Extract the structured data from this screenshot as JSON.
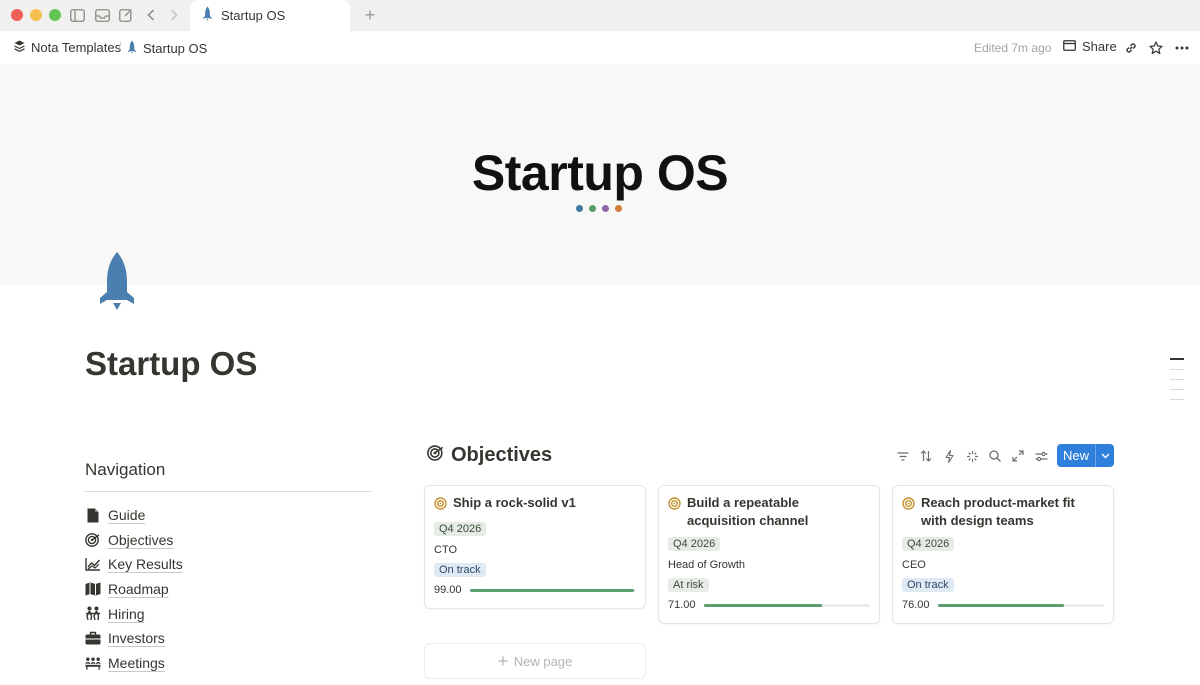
{
  "window": {
    "tab_title": "Startup OS"
  },
  "breadcrumb": {
    "workspace": "Nota Templates",
    "page": "Startup OS"
  },
  "topbar": {
    "edited": "Edited 7m ago",
    "share_label": "Share"
  },
  "cover": {
    "title": "Startup OS",
    "dot_colors": [
      "#3f7a9c",
      "#5b9a6b",
      "#8d6aa6",
      "#d47c3a"
    ]
  },
  "page": {
    "title": "Startup OS",
    "icon": "rocket-icon",
    "icon_color": "#4a7fb0"
  },
  "navigation": {
    "heading": "Navigation",
    "items": [
      {
        "label": "Guide",
        "icon": "document-icon"
      },
      {
        "label": "Objectives",
        "icon": "target-icon"
      },
      {
        "label": "Key Results",
        "icon": "chart-icon"
      },
      {
        "label": "Roadmap",
        "icon": "map-icon"
      },
      {
        "label": "Hiring",
        "icon": "people-icon"
      },
      {
        "label": "Investors",
        "icon": "briefcase-icon"
      },
      {
        "label": "Meetings",
        "icon": "meeting-icon"
      }
    ]
  },
  "objectives": {
    "title": "Objectives",
    "new_label": "New",
    "new_page_label": "New page",
    "cards": [
      {
        "title": "Ship a rock-solid v1",
        "quarter": "Q4 2026",
        "owner": "CTO",
        "status": "On track",
        "progress": "99.00",
        "progress_fraction": 0.99
      },
      {
        "title": "Build a repeatable acquisition channel",
        "quarter": "Q4 2026",
        "owner": "Head of Growth",
        "status": "At risk",
        "progress": "71.00",
        "progress_fraction": 0.71
      },
      {
        "title": "Reach product-market fit with design teams",
        "quarter": "Q4 2026",
        "owner": "CEO",
        "status": "On track",
        "progress": "76.00",
        "progress_fraction": 0.76
      }
    ]
  },
  "colors": {
    "accent": "#2f80dd",
    "progress": "#5a9e6f"
  }
}
